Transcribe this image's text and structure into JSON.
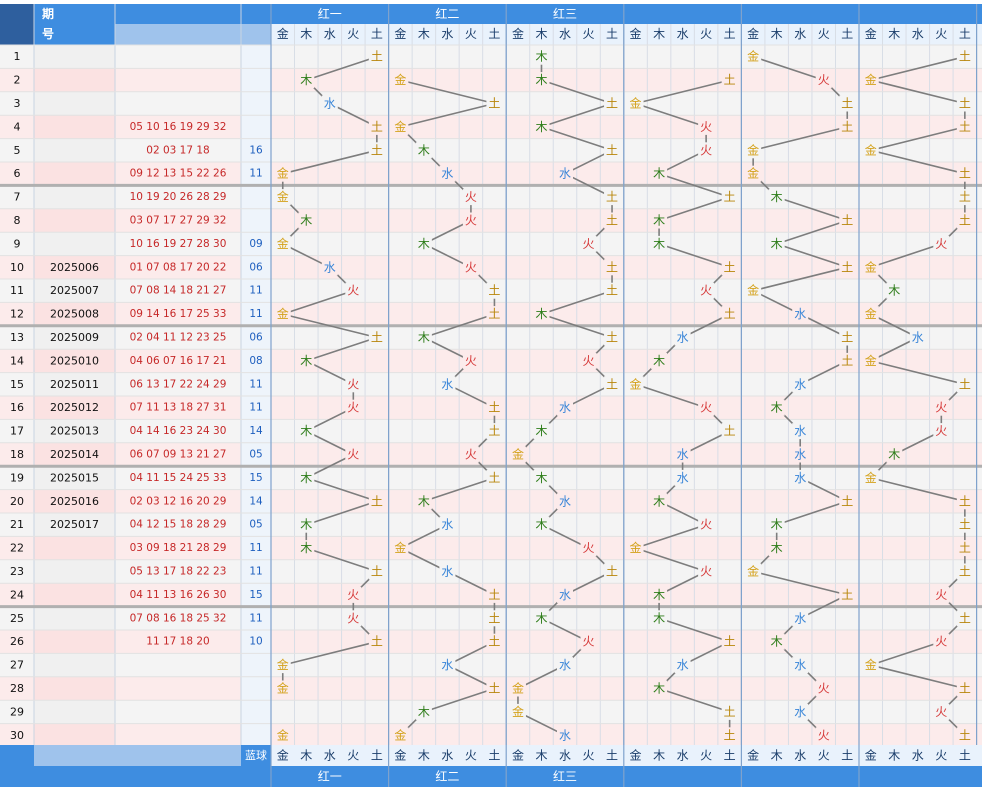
{
  "header": {
    "seq_label": "",
    "period_label": "期号",
    "groups": [
      "红一",
      "红二",
      "红三",
      "",
      "",
      ""
    ],
    "elements": [
      "金",
      "木",
      "水",
      "火",
      "土"
    ]
  },
  "footer": {
    "blue_label": "蓝球",
    "groups": [
      "红一",
      "红二",
      "红三",
      "",
      "",
      ""
    ]
  },
  "chart_data": {
    "type": "table",
    "element_labels": [
      "金",
      "木",
      "水",
      "火",
      "土"
    ],
    "element_colors": {
      "金": "#d4a21c",
      "木": "#2e7d1a",
      "水": "#3a86d8",
      "火": "#d63a3a",
      "土": "#b8860b"
    },
    "rows": [
      {
        "seq": "1",
        "period": "",
        "nums": "",
        "blue": "",
        "el": [
          4,
          null,
          1,
          null,
          0,
          4
        ]
      },
      {
        "seq": "2",
        "period": "",
        "nums": "",
        "blue": "",
        "el": [
          1,
          0,
          1,
          4,
          3,
          0
        ]
      },
      {
        "seq": "3",
        "period": "",
        "nums": "",
        "blue": "",
        "el": [
          2,
          4,
          4,
          0,
          4,
          4
        ]
      },
      {
        "seq": "4",
        "period": "",
        "nums": "05 10 16 19 29 32",
        "blue": "",
        "el": [
          4,
          0,
          1,
          3,
          4,
          4
        ]
      },
      {
        "seq": "5",
        "period": "",
        "nums": "02 03 17 18",
        "blue": "16",
        "el": [
          4,
          1,
          4,
          3,
          0,
          0
        ]
      },
      {
        "seq": "6",
        "period": "",
        "nums": "09 12 13 15 22 26",
        "blue": "11",
        "el": [
          0,
          2,
          2,
          1,
          0,
          4
        ]
      },
      {
        "seq": "7",
        "period": "",
        "nums": "10 19 20 26 28 29",
        "blue": "",
        "el": [
          0,
          3,
          4,
          4,
          1,
          4
        ]
      },
      {
        "seq": "8",
        "period": "",
        "nums": "03 07 17 27 29 32",
        "blue": "",
        "el": [
          1,
          3,
          4,
          1,
          4,
          4
        ]
      },
      {
        "seq": "9",
        "period": "",
        "nums": "10 16 19 27 28 30",
        "blue": "09",
        "el": [
          0,
          1,
          3,
          1,
          1,
          3
        ]
      },
      {
        "seq": "10",
        "period": "2025006",
        "nums": "01 07 08 17 20 22",
        "blue": "06",
        "el": [
          2,
          3,
          4,
          4,
          4,
          0
        ]
      },
      {
        "seq": "11",
        "period": "2025007",
        "nums": "07 08 14 18 21 27",
        "blue": "11",
        "el": [
          3,
          4,
          4,
          3,
          0,
          1
        ]
      },
      {
        "seq": "12",
        "period": "2025008",
        "nums": "09 14 16 17 25 33",
        "blue": "11",
        "el": [
          0,
          4,
          1,
          4,
          2,
          0
        ]
      },
      {
        "seq": "13",
        "period": "2025009",
        "nums": "02 04 11 12 23 25",
        "blue": "06",
        "el": [
          4,
          1,
          4,
          2,
          4,
          2
        ]
      },
      {
        "seq": "14",
        "period": "2025010",
        "nums": "04 06 07 16 17 21",
        "blue": "08",
        "el": [
          1,
          3,
          3,
          1,
          4,
          0
        ]
      },
      {
        "seq": "15",
        "period": "2025011",
        "nums": "06 13 17 22 24 29",
        "blue": "11",
        "el": [
          3,
          2,
          4,
          0,
          2,
          4
        ]
      },
      {
        "seq": "16",
        "period": "2025012",
        "nums": "07 11 13 18 27 31",
        "blue": "11",
        "el": [
          3,
          4,
          2,
          3,
          1,
          3
        ]
      },
      {
        "seq": "17",
        "period": "2025013",
        "nums": "04 14 16 23 24 30",
        "blue": "14",
        "el": [
          1,
          4,
          1,
          4,
          2,
          3
        ]
      },
      {
        "seq": "18",
        "period": "2025014",
        "nums": "06 07 09 13 21 27",
        "blue": "05",
        "el": [
          3,
          3,
          0,
          2,
          2,
          1
        ]
      },
      {
        "seq": "19",
        "period": "2025015",
        "nums": "04 11 15 24 25 33",
        "blue": "15",
        "el": [
          1,
          4,
          1,
          2,
          2,
          0
        ]
      },
      {
        "seq": "20",
        "period": "2025016",
        "nums": "02 03 12 16 20 29",
        "blue": "14",
        "el": [
          4,
          1,
          2,
          1,
          4,
          4
        ]
      },
      {
        "seq": "21",
        "period": "2025017",
        "nums": "04 12 15 18 28 29",
        "blue": "05",
        "el": [
          1,
          2,
          1,
          3,
          1,
          4
        ]
      },
      {
        "seq": "22",
        "period": "",
        "nums": "03 09 18 21 28 29",
        "blue": "11",
        "el": [
          1,
          0,
          3,
          0,
          1,
          4
        ]
      },
      {
        "seq": "23",
        "period": "",
        "nums": "05 13 17 18 22 23",
        "blue": "11",
        "el": [
          4,
          2,
          4,
          3,
          0,
          4
        ]
      },
      {
        "seq": "24",
        "period": "",
        "nums": "04 11 13 16 26 30",
        "blue": "15",
        "el": [
          3,
          4,
          2,
          1,
          4,
          3
        ]
      },
      {
        "seq": "25",
        "period": "",
        "nums": "07 08 16 18 25 32",
        "blue": "11",
        "el": [
          3,
          4,
          1,
          1,
          2,
          4
        ]
      },
      {
        "seq": "26",
        "period": "",
        "nums": "11 17 18 20",
        "blue": "10",
        "el": [
          4,
          4,
          3,
          4,
          1,
          3
        ]
      },
      {
        "seq": "27",
        "period": "",
        "nums": "",
        "blue": "",
        "el": [
          0,
          2,
          2,
          2,
          2,
          0
        ]
      },
      {
        "seq": "28",
        "period": "",
        "nums": "",
        "blue": "",
        "el": [
          0,
          4,
          0,
          1,
          3,
          4
        ]
      },
      {
        "seq": "29",
        "period": "",
        "nums": "",
        "blue": "",
        "el": [
          null,
          1,
          0,
          4,
          2,
          3
        ]
      },
      {
        "seq": "30",
        "period": "",
        "nums": "",
        "blue": "",
        "el": [
          0,
          0,
          2,
          4,
          3,
          4
        ]
      }
    ]
  }
}
